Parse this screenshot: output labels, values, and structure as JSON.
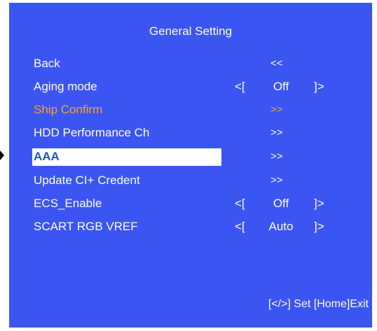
{
  "menu": {
    "title": "General Setting",
    "items": [
      {
        "label": "Back",
        "nav": "<<"
      },
      {
        "label": "Aging mode",
        "left_bracket": "<[",
        "value": "Off",
        "right_bracket": "]>"
      },
      {
        "label": "Ship Confirm",
        "nav": ">>"
      },
      {
        "label": "HDD Performance Ch",
        "nav": ">>"
      },
      {
        "label": "AAA",
        "nav": ">>"
      },
      {
        "label": "Update CI+ Credent",
        "nav": ">>"
      },
      {
        "label": "ECS_Enable",
        "left_bracket": "<[",
        "value": "Off",
        "right_bracket": "]>"
      },
      {
        "label": "SCART RGB VREF",
        "left_bracket": "<[",
        "value": "Auto",
        "right_bracket": "]>"
      }
    ],
    "footer": "[</>] Set [Home]Exit"
  },
  "colors": {
    "panel_background": "#3b55f2",
    "text": "#ffffff",
    "highlight_text": "#f5a623",
    "selected_background": "#ffffff",
    "selected_text": "#1f4fd8"
  }
}
